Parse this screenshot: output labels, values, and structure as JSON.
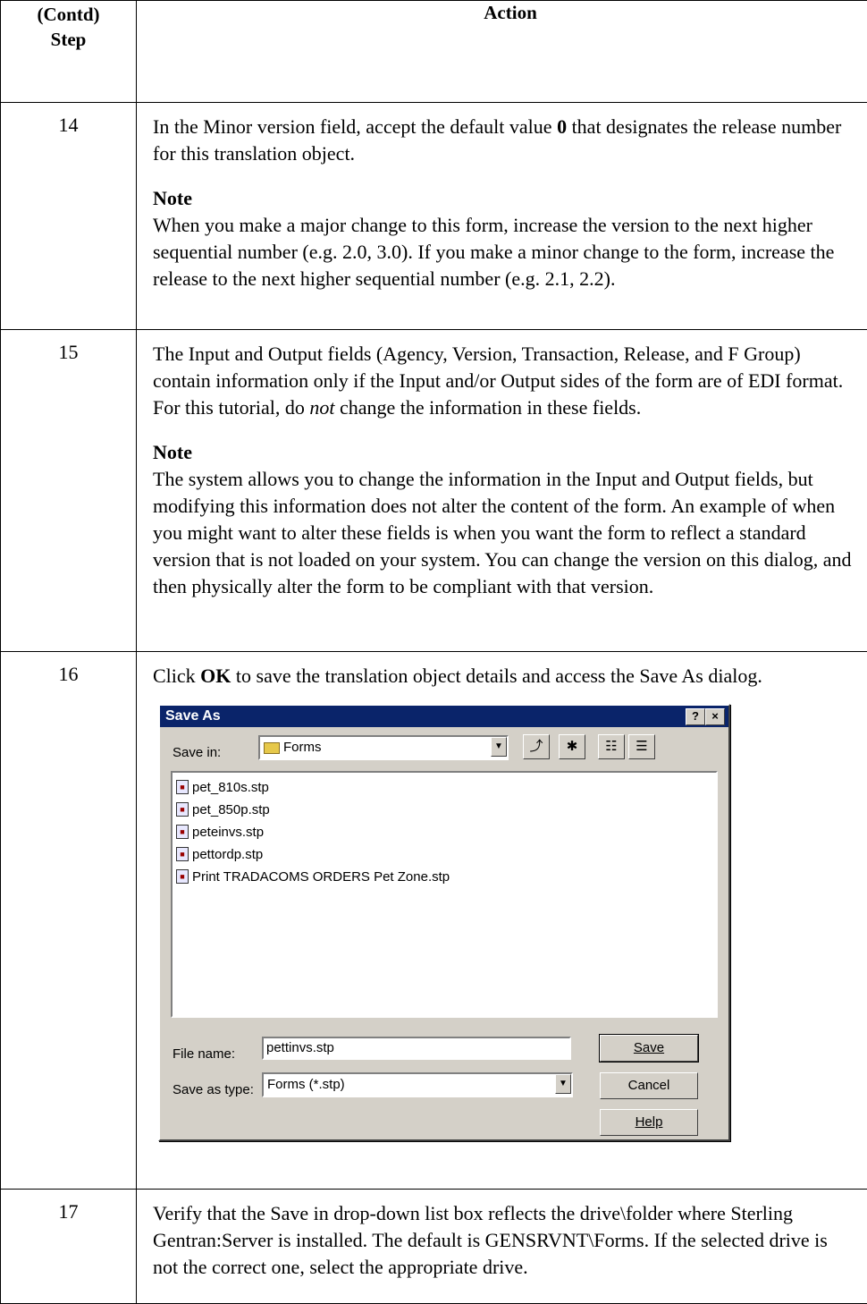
{
  "header": {
    "step_line1": "(Contd)",
    "step_line2": "Step",
    "action": "Action"
  },
  "rows": [
    {
      "num": "14",
      "p1_a": "In the Minor version field, accept the default value ",
      "p1_b": "0",
      "p1_c": " that designates the release number for this translation object.",
      "note_title": "Note",
      "note_text": "When you make a major change to this form, increase the version to the next higher sequential number (e.g. 2.0, 3.0). If you make a minor change to the form, increase the release to the next higher sequential number (e.g. 2.1, 2.2)."
    },
    {
      "num": "15",
      "p1_a": "The Input and Output fields (Agency, Version, Transaction, Release, and F Group) contain information only if the Input and/or Output sides of the form are of EDI format. For this tutorial, do ",
      "p1_b": "not",
      "p1_c": " change the information in these fields.",
      "note_title": "Note",
      "note_text": "The system allows you to change the information in the Input and Output fields, but modifying this information does not alter the content of the form. An example of when you might want to alter these fields is when you want the form to reflect a standard version that is not loaded on your system. You can change the version on this dialog, and then physically alter the form to be compliant with that version."
    },
    {
      "num": "16",
      "p1_a": "Click ",
      "p1_b": "OK",
      "p1_c": " to save the translation object details and access the Save As dialog."
    },
    {
      "num": "17",
      "text": "Verify that the Save in drop-down list box reflects the drive\\folder where Sterling Gentran:Server is installed. The default is GENSRVNT\\Forms. If the selected drive is not the correct one, select the appropriate drive."
    }
  ],
  "dialog": {
    "title": "Save As",
    "help_btn": "?",
    "close_btn": "×",
    "save_in_label": "Save in:",
    "save_in_value": "Forms",
    "files": [
      "pet_810s.stp",
      "pet_850p.stp",
      "peteinvs.stp",
      "pettordp.stp",
      "Print TRADACOMS ORDERS Pet Zone.stp"
    ],
    "file_name_label": "File name:",
    "file_name_value": "pettinvs.stp",
    "save_type_label": "Save as type:",
    "save_type_value": "Forms (*.stp)",
    "save_button": "Save",
    "cancel_button": "Cancel",
    "help_button": "Help"
  }
}
